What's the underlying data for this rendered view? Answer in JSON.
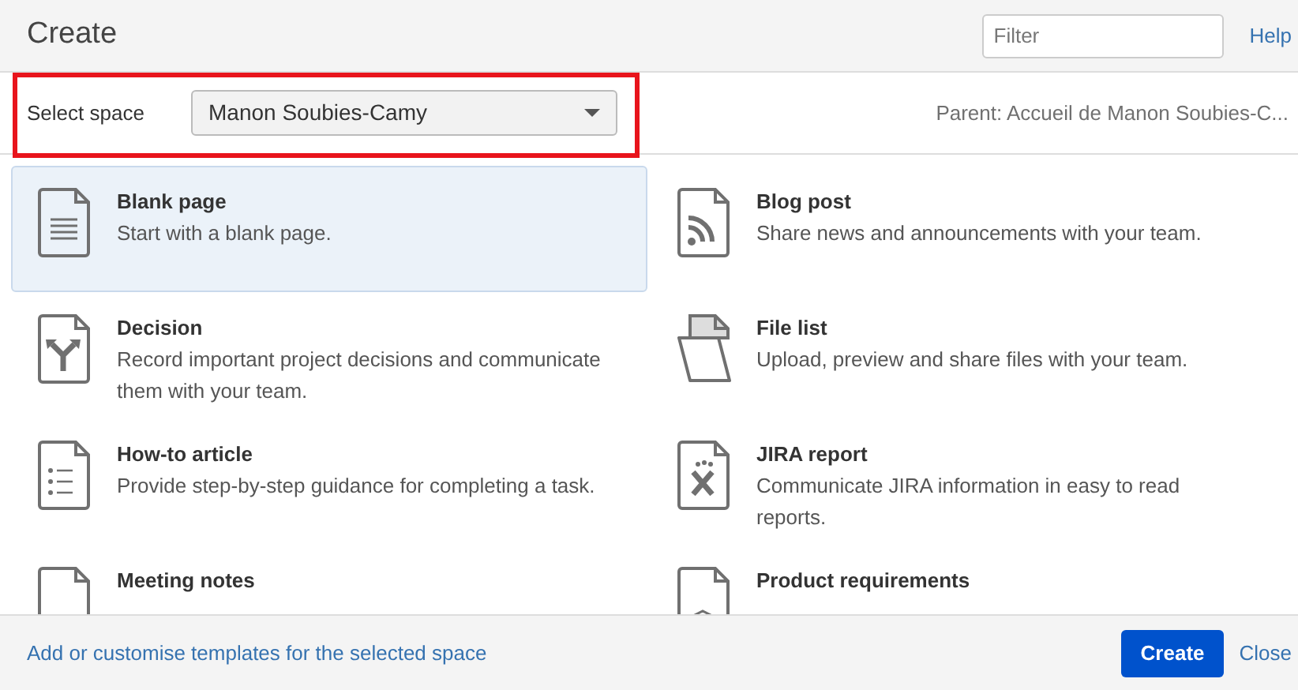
{
  "dialog": {
    "title": "Create",
    "filter": {
      "placeholder": "Filter"
    },
    "help_link": "Help"
  },
  "space_selector": {
    "label": "Select space",
    "value": "Manon Soubies-Camy",
    "parent": "Parent: Accueil de Manon Soubies-C..."
  },
  "templates": [
    {
      "kind": "blank",
      "title": "Blank page",
      "description": "Start with a blank page.",
      "selected": true
    },
    {
      "kind": "blog",
      "title": "Blog post",
      "description": "Share news and announcements with your team.",
      "selected": false
    },
    {
      "kind": "decision",
      "title": "Decision",
      "description": "Record important project decisions and communicate them with your team.",
      "selected": false
    },
    {
      "kind": "filelist",
      "title": "File list",
      "description": "Upload, preview and share files with your team.",
      "selected": false
    },
    {
      "kind": "howto",
      "title": "How-to article",
      "description": "Provide step-by-step guidance for completing a task.",
      "selected": false
    },
    {
      "kind": "jira",
      "title": "JIRA report",
      "description": "Communicate JIRA information in easy to read reports.",
      "selected": false
    },
    {
      "kind": "meeting",
      "title": "Meeting notes",
      "selected": false
    },
    {
      "kind": "product",
      "title": "Product requirements",
      "selected": false
    }
  ],
  "footer": {
    "templates_link": "Add or customise templates for the selected space",
    "create_button": "Create",
    "close_link": "Close"
  }
}
